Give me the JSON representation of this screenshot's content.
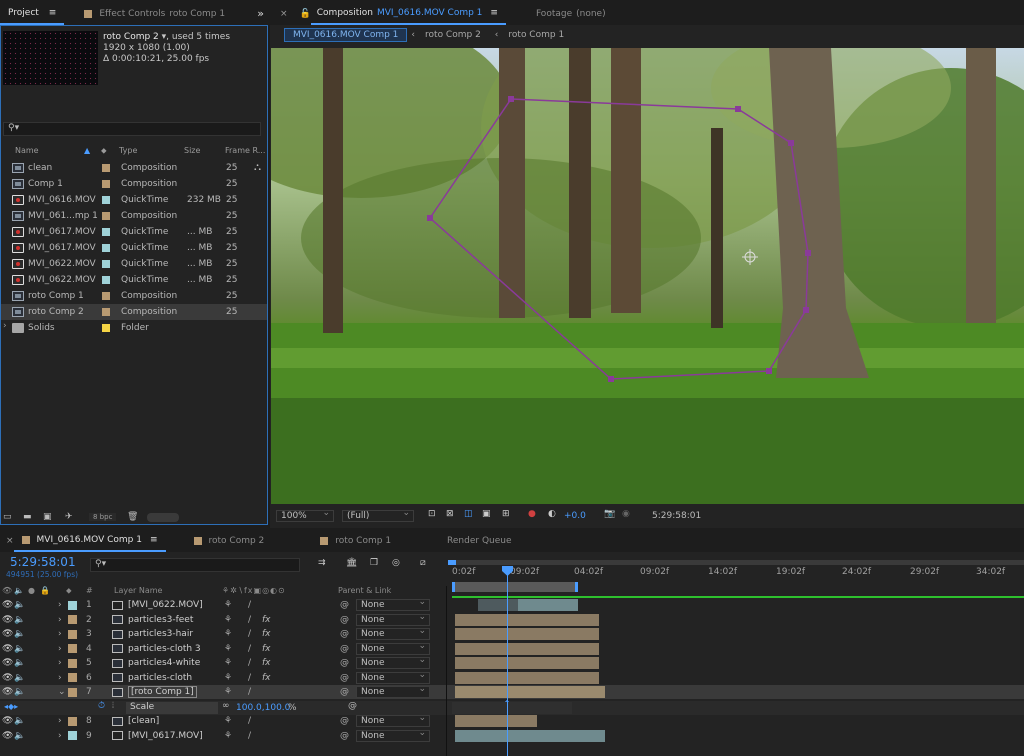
{
  "project_panel": {
    "tab_project": "Project",
    "tab_effect_controls": "Effect Controls",
    "effect_controls_target": "roto Comp 1",
    "preview": {
      "name": "roto Comp 2",
      "used": ", used 5 times",
      "dims": "1920 x 1080 (1.00)",
      "duration": "Δ 0:00:10:21, 25.00 fps"
    },
    "search_icon": "search-icon",
    "columns": {
      "name": "Name",
      "type": "Type",
      "size": "Size",
      "frame_rate": "Frame R..."
    },
    "items": [
      {
        "name": "clean",
        "type": "Composition",
        "size": "",
        "fr": "25",
        "icon": "comp",
        "label": "#b89a72"
      },
      {
        "name": "Comp 1",
        "type": "Composition",
        "size": "",
        "fr": "25",
        "icon": "comp",
        "label": "#b89a72"
      },
      {
        "name": "MVI_0616.MOV",
        "type": "QuickTime",
        "size": "232 MB",
        "fr": "25",
        "icon": "qt",
        "label": "#9fd2d8"
      },
      {
        "name": "MVI_061...mp 1",
        "type": "Composition",
        "size": "",
        "fr": "25",
        "icon": "comp",
        "label": "#b89a72"
      },
      {
        "name": "MVI_0617.MOV",
        "type": "QuickTime",
        "size": "... MB",
        "fr": "25",
        "icon": "qt",
        "label": "#9fd2d8"
      },
      {
        "name": "MVI_0617.MOV",
        "type": "QuickTime",
        "size": "... MB",
        "fr": "25",
        "icon": "qt",
        "label": "#9fd2d8"
      },
      {
        "name": "MVI_0622.MOV",
        "type": "QuickTime",
        "size": "... MB",
        "fr": "25",
        "icon": "qt",
        "label": "#9fd2d8"
      },
      {
        "name": "MVI_0622.MOV",
        "type": "QuickTime",
        "size": "... MB",
        "fr": "25",
        "icon": "qt",
        "label": "#9fd2d8"
      },
      {
        "name": "roto Comp 1",
        "type": "Composition",
        "size": "",
        "fr": "25",
        "icon": "comp",
        "label": "#b89a72"
      },
      {
        "name": "roto Comp 2",
        "type": "Composition",
        "size": "",
        "fr": "25",
        "icon": "comp",
        "label": "#b89a72",
        "selected": true
      },
      {
        "name": "Solids",
        "type": "Folder",
        "size": "",
        "fr": "",
        "icon": "folder",
        "label": "#f5d445"
      }
    ],
    "bpc": "8 bpc"
  },
  "composition_panel": {
    "tab_label": "Composition",
    "tab_comp_name": "MVI_0616.MOV Comp 1",
    "footage_tab": "Footage",
    "footage_value": "(none)",
    "breadcrumbs": [
      "MVI_0616.MOV Comp 1",
      "roto Comp 2",
      "roto Comp 1"
    ],
    "zoom": "100%",
    "resolution": "(Full)",
    "exposure": "+0.0",
    "timecode": "5:29:58:01"
  },
  "timeline": {
    "tabs": [
      "MVI_0616.MOV Comp 1",
      "roto Comp 2",
      "roto Comp 1",
      "Render Queue"
    ],
    "timecode": "5:29:58:01",
    "frames": "494951 (25.00 fps)",
    "col_hash": "#",
    "col_layer_name": "Layer Name",
    "col_parent": "Parent & Link",
    "ruler": [
      "0:02f",
      "09:02f",
      "04:02f",
      "09:02f",
      "14:02f",
      "19:02f",
      "24:02f",
      "29:02f",
      "34:02f"
    ],
    "layers": [
      {
        "num": "1",
        "name": "[MVI_0622.MOV]",
        "icon": "qt",
        "label": "#9fd2d8",
        "fx": false,
        "parent": "None"
      },
      {
        "num": "2",
        "name": "particles3-feet",
        "icon": "comp",
        "label": "#b89a72",
        "fx": true,
        "parent": "None"
      },
      {
        "num": "3",
        "name": "particles3-hair",
        "icon": "comp",
        "label": "#b89a72",
        "fx": true,
        "parent": "None"
      },
      {
        "num": "4",
        "name": "particles-cloth 3",
        "icon": "comp",
        "label": "#b89a72",
        "fx": true,
        "parent": "None"
      },
      {
        "num": "5",
        "name": "particles4-white",
        "icon": "comp",
        "label": "#b89a72",
        "fx": true,
        "parent": "None"
      },
      {
        "num": "6",
        "name": "particles-cloth",
        "icon": "comp",
        "label": "#b89a72",
        "fx": true,
        "parent": "None"
      },
      {
        "num": "7",
        "name": "[roto Comp 1]",
        "icon": "comp",
        "label": "#b89a72",
        "fx": false,
        "parent": "None",
        "selected": true
      },
      {
        "num": "8",
        "name": "[clean]",
        "icon": "comp",
        "label": "#b89a72",
        "fx": false,
        "parent": "None"
      },
      {
        "num": "9",
        "name": "[MVI_0617.MOV]",
        "icon": "qt",
        "label": "#9fd2d8",
        "fx": false,
        "parent": "None"
      }
    ],
    "scale_label": "Scale",
    "scale_value": "100.0,100.0",
    "scale_unit": "%"
  }
}
